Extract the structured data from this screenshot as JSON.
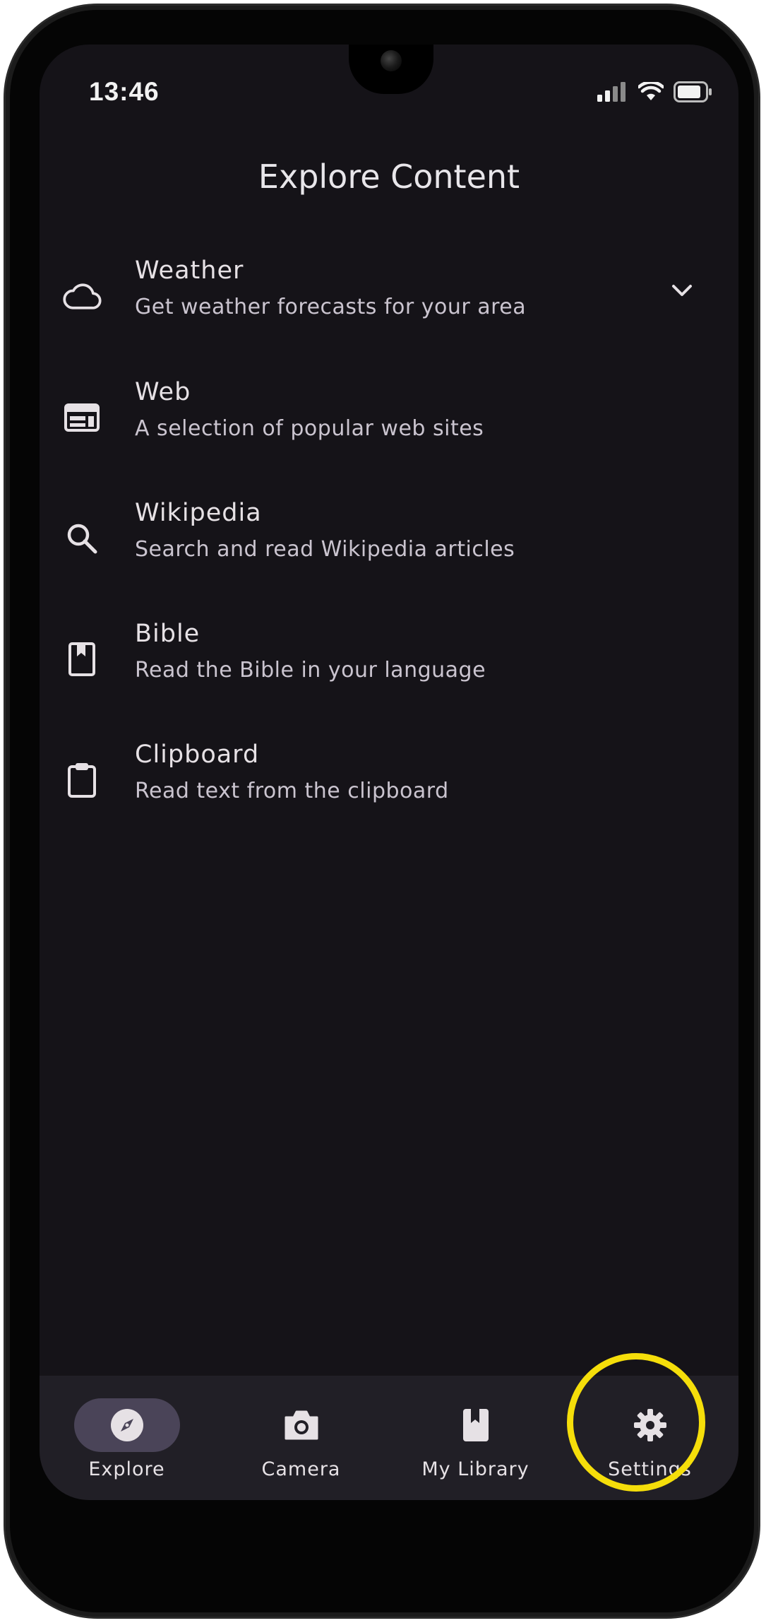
{
  "status_bar": {
    "time": "13:46"
  },
  "header": {
    "title": "Explore Content"
  },
  "content_list": {
    "items": [
      {
        "title": "Weather",
        "subtitle": "Get weather forecasts for your area",
        "icon": "cloud-icon",
        "expandable": true
      },
      {
        "title": "Web",
        "subtitle": "A selection of popular web sites",
        "icon": "web-icon"
      },
      {
        "title": "Wikipedia",
        "subtitle": "Search and read Wikipedia articles",
        "icon": "search-icon"
      },
      {
        "title": "Bible",
        "subtitle": "Read the Bible in your language",
        "icon": "book-icon"
      },
      {
        "title": "Clipboard",
        "subtitle": "Read text from the clipboard",
        "icon": "clipboard-icon"
      }
    ]
  },
  "bottom_nav": {
    "items": [
      {
        "label": "Explore",
        "icon": "compass-icon",
        "active": true
      },
      {
        "label": "Camera",
        "icon": "camera-icon",
        "active": false
      },
      {
        "label": "My Library",
        "icon": "library-book-icon",
        "active": false
      },
      {
        "label": "Settings",
        "icon": "gear-icon",
        "active": false
      }
    ]
  },
  "colors": {
    "background": "#151318",
    "nav_background": "#211f26",
    "active_pill": "#4a4458",
    "highlight_ring": "#f5de0a"
  }
}
